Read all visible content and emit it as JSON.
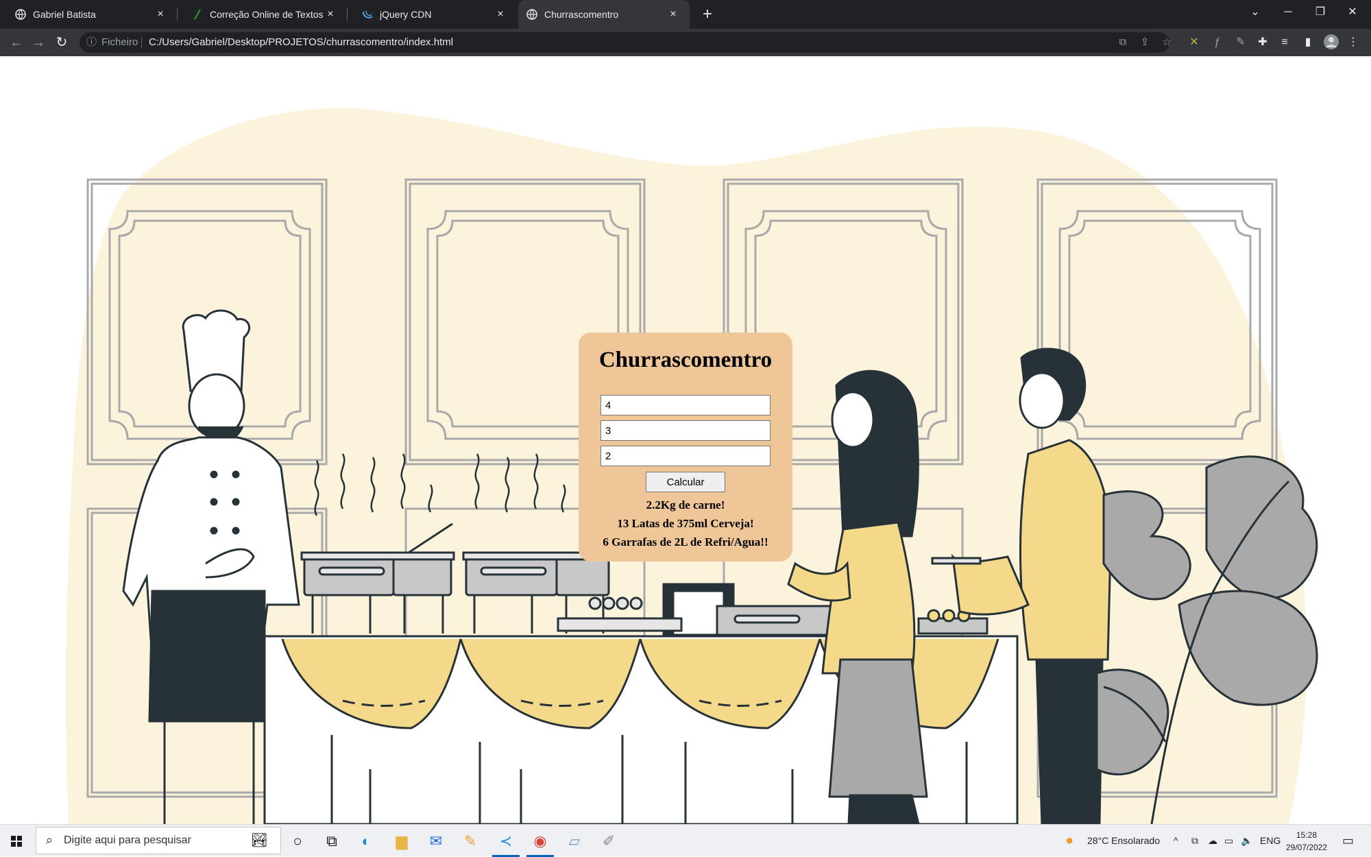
{
  "browser": {
    "tabs": [
      {
        "title": "Gabriel Batista"
      },
      {
        "title": "Correção Online de Textos"
      },
      {
        "title": "jQuery CDN"
      },
      {
        "title": "Churrascomentro"
      }
    ],
    "close_glyph": "×",
    "new_tab_glyph": "+",
    "address": {
      "security_label": "Ficheiro",
      "url": "C:/Users/Gabriel/Desktop/PROJETOS/churrascomentro/index.html"
    }
  },
  "app": {
    "title": "Churrascomentro",
    "inputs": [
      {
        "value": "4"
      },
      {
        "value": "3"
      },
      {
        "value": "2"
      }
    ],
    "button_label": "Calcular",
    "results": [
      "2.2Kg de carne!",
      "13 Latas de 375ml Cerveja!",
      "6 Garrafas de 2L de Refri/Agua!!"
    ],
    "colors": {
      "card_bg": "#eec698",
      "blob": "#fcf3dc",
      "accent_yellow": "#f5d98a",
      "dark": "#263238",
      "grey": "#a9a9a9"
    }
  },
  "taskbar": {
    "search_placeholder": "Digite aqui para pesquisar",
    "weather": "28°C  Ensolarado",
    "language": "ENG",
    "time": "15:28",
    "date": "29/07/2022"
  }
}
